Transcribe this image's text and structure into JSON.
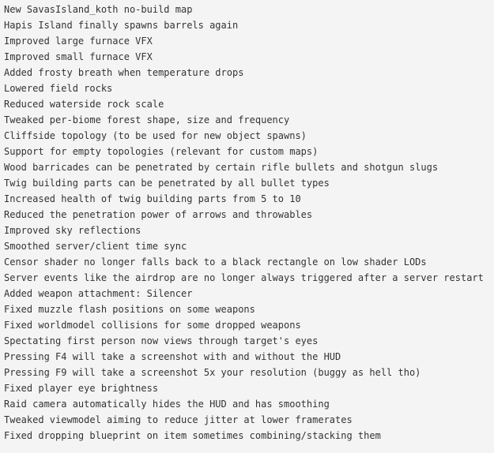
{
  "document": {
    "kind": "changelog",
    "background_color": "#f4f4f4",
    "text_color": "#333333",
    "entries": [
      {
        "text": "New SavasIsland_koth no-build map"
      },
      {
        "text": "Hapis Island finally spawns barrels again"
      },
      {
        "text": "Improved large furnace VFX"
      },
      {
        "text": "Improved small furnace VFX"
      },
      {
        "text": "Added frosty breath when temperature drops"
      },
      {
        "text": "Lowered field rocks"
      },
      {
        "text": "Reduced waterside rock scale"
      },
      {
        "text": "Tweaked per-biome forest shape, size and frequency"
      },
      {
        "text": "Cliffside topology (to be used for new object spawns)"
      },
      {
        "text": "Support for empty topologies (relevant for custom maps)"
      },
      {
        "text": "Wood barricades can be penetrated by certain rifle bullets and shotgun slugs"
      },
      {
        "text": "Twig building parts can be penetrated by all bullet types"
      },
      {
        "text": "Increased health of twig building parts from 5 to 10"
      },
      {
        "text": "Reduced the penetration power of arrows and throwables"
      },
      {
        "text": "Improved sky reflections"
      },
      {
        "text": "Smoothed server/client time sync"
      },
      {
        "text": "Censor shader no longer falls back to a black rectangle on low shader LODs"
      },
      {
        "text": "Server events like the airdrop are no longer always triggered after a server restart"
      },
      {
        "text": "Added weapon attachment: Silencer"
      },
      {
        "text": "Fixed muzzle flash positions on some weapons"
      },
      {
        "text": "Fixed worldmodel collisions for some dropped weapons"
      },
      {
        "text": "Spectating first person now views through target's eyes"
      },
      {
        "text": "Pressing F4 will take a screenshot with and without the HUD"
      },
      {
        "text": "Pressing F9 will take a screenshot 5x your resolution (buggy as hell tho)"
      },
      {
        "text": "Fixed player eye brightness"
      },
      {
        "text": "Raid camera automatically hides the HUD and has smoothing"
      },
      {
        "text": "Tweaked viewmodel aiming to reduce jitter at lower framerates"
      },
      {
        "text": "Fixed dropping blueprint on item sometimes combining/stacking them"
      }
    ]
  }
}
